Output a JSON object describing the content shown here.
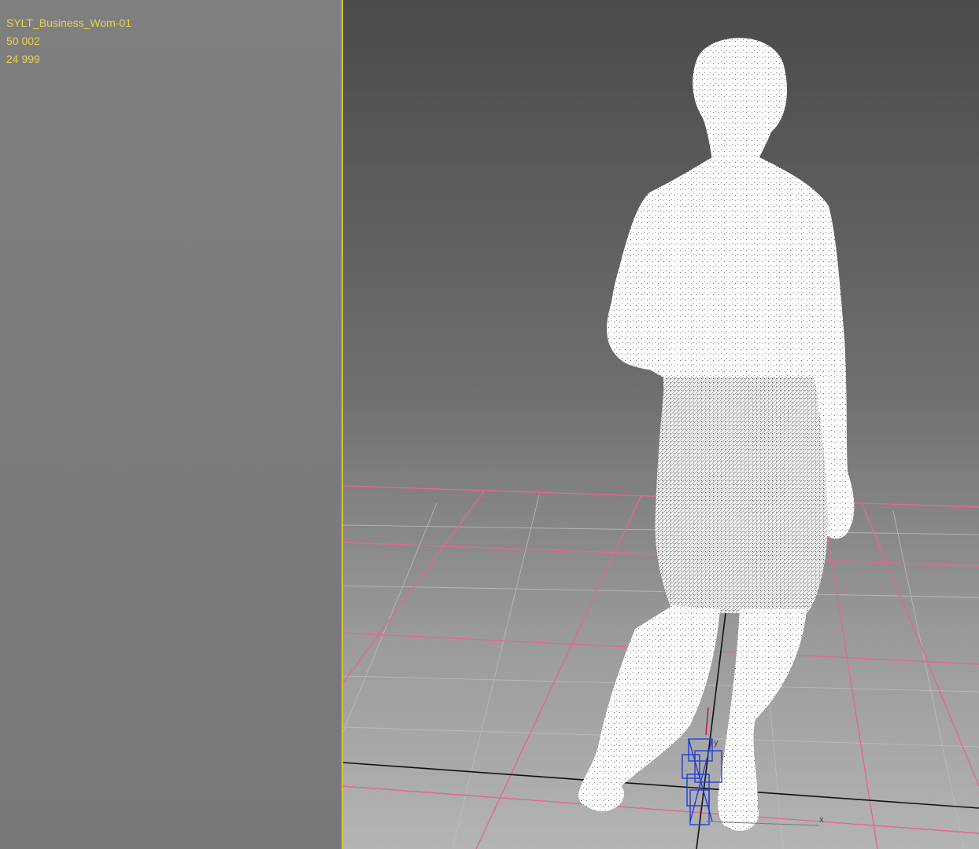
{
  "stats": {
    "object_name": "SYLT_Business_Wom-01",
    "polygons": "50 002",
    "vertices": "24 999"
  },
  "gizmo": {
    "y_label": "y",
    "x_label": "x"
  },
  "colors": {
    "grid_major": "#e06a8c",
    "grid_minor": "#b9b9b9",
    "mesh": "#ffffff",
    "helper": "#1f3fd0",
    "stats_text": "#e8d24a",
    "viewport_border": "#d4c33a"
  }
}
